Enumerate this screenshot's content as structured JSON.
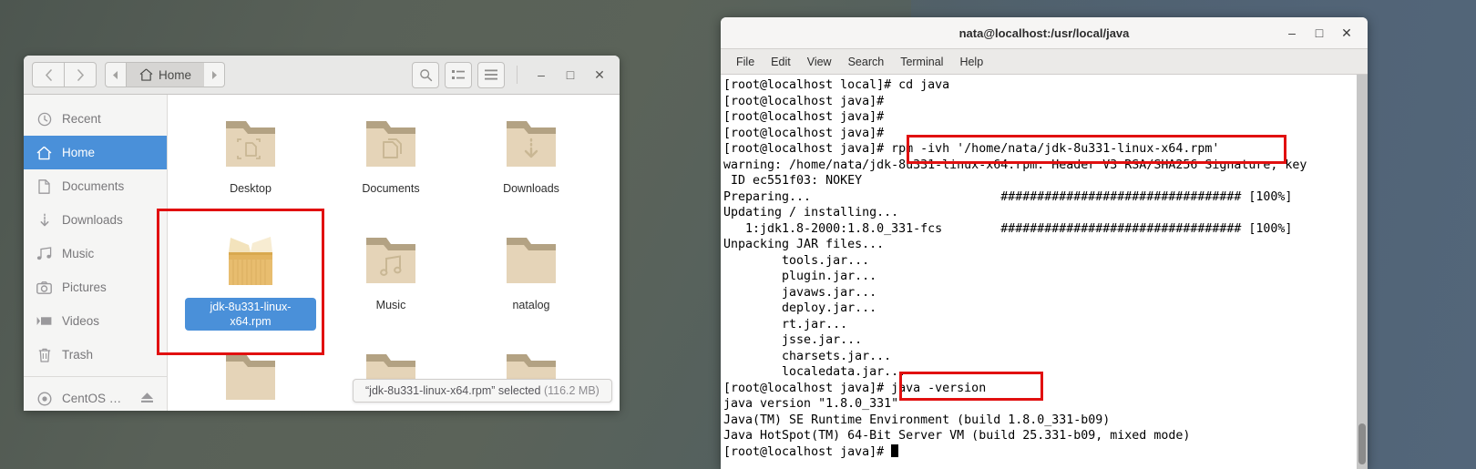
{
  "desktop": {
    "background_left": "#555e57",
    "background_right": "#516375"
  },
  "file_manager": {
    "nav": {
      "back_icon": "chevron-left-icon",
      "forward_icon": "chevron-right-icon",
      "breadcrumb_prev_icon": "triangle-left-icon",
      "breadcrumb_next_icon": "triangle-right-icon",
      "current_location": "Home",
      "home_icon": "home-icon"
    },
    "toolbar": {
      "search_icon": "search-icon",
      "view_list_icon": "list-view-icon",
      "menu_icon": "hamburger-menu-icon",
      "minimize_label": "–",
      "maximize_label": "□",
      "close_label": "✕"
    },
    "sidebar": {
      "items": [
        {
          "label": "Recent",
          "icon": "clock-icon",
          "active": false
        },
        {
          "label": "Home",
          "icon": "home-icon",
          "active": true
        },
        {
          "label": "Documents",
          "icon": "document-icon",
          "active": false
        },
        {
          "label": "Downloads",
          "icon": "download-icon",
          "active": false
        },
        {
          "label": "Music",
          "icon": "music-note-icon",
          "active": false
        },
        {
          "label": "Pictures",
          "icon": "camera-icon",
          "active": false
        },
        {
          "label": "Videos",
          "icon": "video-icon",
          "active": false
        },
        {
          "label": "Trash",
          "icon": "trash-icon",
          "active": false
        }
      ],
      "devices": [
        {
          "label": "CentOS …",
          "icon": "disc-icon",
          "eject_icon": "eject-icon"
        }
      ]
    },
    "files": [
      {
        "name": "Desktop",
        "type": "folder",
        "icon": "folder-desktop-icon",
        "selected": false
      },
      {
        "name": "Documents",
        "type": "folder",
        "icon": "folder-documents-icon",
        "selected": false
      },
      {
        "name": "Downloads",
        "type": "folder",
        "icon": "folder-downloads-icon",
        "selected": false
      },
      {
        "name": "jdk-8u331-linux-x64.rpm",
        "type": "package",
        "icon": "package-box-icon",
        "selected": true
      },
      {
        "name": "Music",
        "type": "folder",
        "icon": "folder-music-icon",
        "selected": false
      },
      {
        "name": "natalog",
        "type": "folder",
        "icon": "folder-icon",
        "selected": false
      },
      {
        "name": "",
        "type": "folder",
        "icon": "folder-icon",
        "selected": false
      },
      {
        "name": "",
        "type": "folder",
        "icon": "folder-icon",
        "selected": false
      },
      {
        "name": "",
        "type": "folder",
        "icon": "folder-icon",
        "selected": false
      }
    ],
    "status_bar": {
      "selection_text": "“jdk-8u331-linux-x64.rpm” selected",
      "size_text": "(116.2 MB)"
    },
    "annotation": {
      "highlight_color": "#e11010",
      "highlighted_file": "jdk-8u331-linux-x64.rpm"
    }
  },
  "terminal": {
    "title": "nata@localhost:/usr/local/java",
    "window_buttons": {
      "minimize_label": "–",
      "maximize_label": "□",
      "close_label": "✕"
    },
    "menu": [
      "File",
      "Edit",
      "View",
      "Search",
      "Terminal",
      "Help"
    ],
    "highlight_color": "#e11010",
    "highlighted_commands": [
      "rpm -ivh '/home/nata/jdk-8u331-linux-x64.rpm'",
      "java -version"
    ],
    "output": "[root@localhost local]# cd java\n[root@localhost java]#\n[root@localhost java]#\n[root@localhost java]#\n[root@localhost java]# rpm -ivh '/home/nata/jdk-8u331-linux-x64.rpm'\nwarning: /home/nata/jdk-8u331-linux-x64.rpm: Header V3 RSA/SHA256 Signature, key\n ID ec551f03: NOKEY\nPreparing...                          ################################# [100%]\nUpdating / installing...\n   1:jdk1.8-2000:1.8.0_331-fcs        ################################# [100%]\nUnpacking JAR files...\n        tools.jar...\n        plugin.jar...\n        javaws.jar...\n        deploy.jar...\n        rt.jar...\n        jsse.jar...\n        charsets.jar...\n        localedata.jar...\n[root@localhost java]# java -version\njava version \"1.8.0_331\"\nJava(TM) SE Runtime Environment (build 1.8.0_331-b09)\nJava HotSpot(TM) 64-Bit Server VM (build 25.331-b09, mixed mode)\n[root@localhost java]# ",
    "scrollbar": {
      "position": "bottom"
    }
  }
}
